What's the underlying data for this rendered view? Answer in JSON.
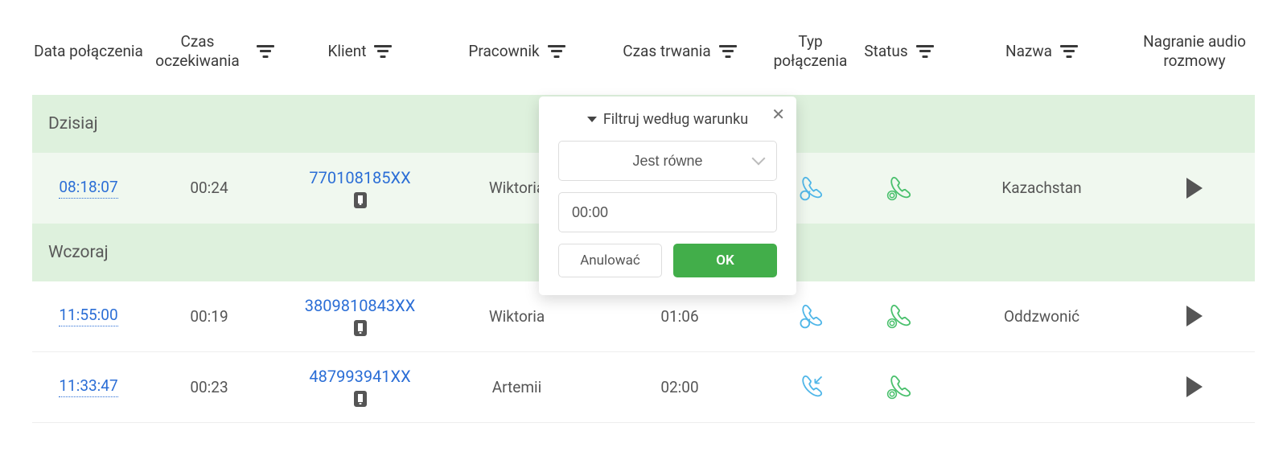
{
  "headers": {
    "date": "Data połączenia",
    "wait": "Czas oczekiwania",
    "client": "Klient",
    "employee": "Pracownik",
    "duration": "Czas trwania",
    "type": "Typ połączenia",
    "status": "Status",
    "name": "Nazwa",
    "audio": "Nagranie audio rozmowy"
  },
  "groups": {
    "today": "Dzisiaj",
    "yesterday": "Wczoraj"
  },
  "rows": [
    {
      "time": "08:18:07",
      "wait": "00:24",
      "client": "770108185XX",
      "employee": "Wiktoria",
      "duration": "",
      "name": "Kazachstan",
      "type": "callback",
      "status": "ok"
    },
    {
      "time": "11:55:00",
      "wait": "00:19",
      "client": "3809810843XX",
      "employee": "Wiktoria",
      "duration": "01:06",
      "name": "Oddzwonić",
      "type": "callback",
      "status": "ok"
    },
    {
      "time": "11:33:47",
      "wait": "00:23",
      "client": "487993941XX",
      "employee": "Artemii",
      "duration": "02:00",
      "name": "",
      "type": "incoming",
      "status": "ok"
    }
  ],
  "popover": {
    "title": "Filtruj według warunku",
    "condition": "Jest równe",
    "value": "00:00",
    "cancel": "Anulować",
    "ok": "OK"
  }
}
